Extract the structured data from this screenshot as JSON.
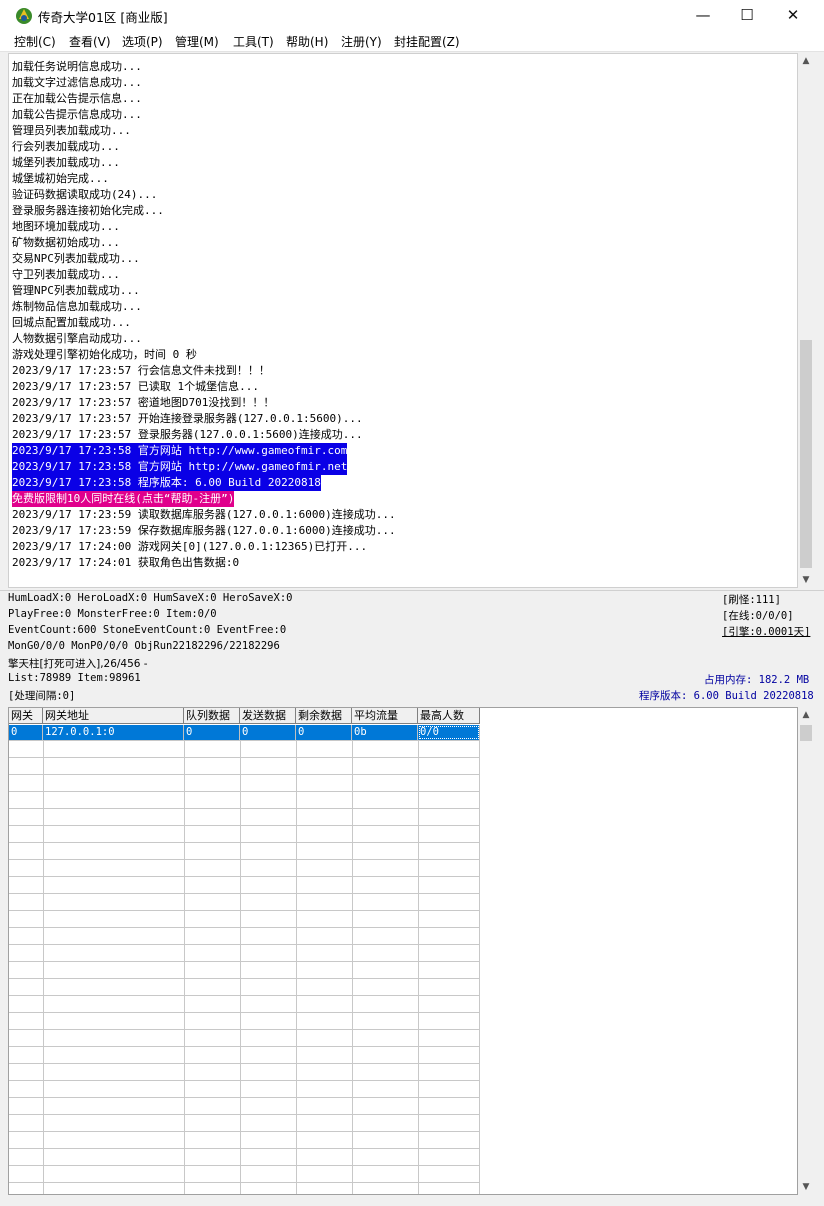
{
  "window": {
    "title": "传奇大学01区 [商业版]",
    "minimize": "—",
    "maximize": "☐",
    "close": "✕"
  },
  "menu": [
    "控制(C)",
    "查看(V)",
    "选项(P)",
    "管理(M)",
    "工具(T)",
    "帮助(H)",
    "注册(Y)",
    "封挂配置(Z)"
  ],
  "log": {
    "lines": [
      "加载任务说明信息成功...",
      "加载文字过滤信息成功...",
      "正在加载公告提示信息...",
      "加载公告提示信息成功...",
      "管理员列表加载成功...",
      "行会列表加载成功...",
      "城堡列表加载成功...",
      "城堡城初始完成...",
      "验证码数据读取成功(24)...",
      "登录服务器连接初始化完成...",
      "地图环境加载成功...",
      "矿物数据初始成功...",
      "交易NPC列表加载成功...",
      "守卫列表加载成功...",
      "管理NPC列表加载成功...",
      "炼制物品信息加载成功...",
      "回城点配置加载成功...",
      "人物数据引擎启动成功...",
      "游戏处理引擎初始化成功，时间 0 秒",
      "2023/9/17 17:23:57 行会信息文件未找到！！！",
      "2023/9/17 17:23:57 已读取 1个城堡信息...",
      "2023/9/17 17:23:57 密道地图D701没找到！！！",
      "2023/9/17 17:23:57 开始连接登录服务器(127.0.0.1:5600)...",
      "2023/9/17 17:23:57 登录服务器(127.0.0.1:5600)连接成功...",
      "2023/9/17 17:23:58 官方网站 http://www.gameofmir.com",
      "2023/9/17 17:23:58 官方网站 http://www.gameofmir.net",
      "2023/9/17 17:23:58 程序版本: 6.00 Build 20220818",
      "免费版限制10人同时在线(点击“帮助-注册”)",
      "2023/9/17 17:23:59 读取数据库服务器(127.0.0.1:6000)连接成功...",
      "2023/9/17 17:23:59 保存数据库服务器(127.0.0.1:6000)连接成功...",
      "2023/9/17 17:24:00 游戏网关[0](127.0.0.1:12365)已打开...",
      "2023/9/17 17:24:01 获取角色出售数据:0"
    ],
    "highlight_blue_color": "#0a00e6",
    "highlight_pink_color": "#e0008c"
  },
  "status": {
    "line1": "HumLoadX:0 HeroLoadX:0 HumSaveX:0 HeroSaveX:0",
    "line2": "PlayFree:0 MonsterFree:0 Item:0/0",
    "line3": "EventCount:600 StoneEventCount:0 EventFree:0",
    "line4": "MonG0/0/0 MonP0/0/0 ObjRun22182296/22182296",
    "line5": "擎天柱[打死可进入],26/456 -",
    "line6": "List:78989 Item:98961",
    "line7": "[处理间隔:0]",
    "monster_refresh": "[刷怪:111]",
    "online": "[在线:0/0/0]",
    "engine": "[引擎:0.0001天]",
    "memory": "占用内存: 182.2 MB",
    "version": "程序版本: 6.00 Build 20220818"
  },
  "grid": {
    "columns": [
      "网关",
      "网关地址",
      "队列数据",
      "发送数据",
      "剩余数据",
      "平均流量",
      "最高人数"
    ],
    "rows": [
      [
        "0",
        "127.0.0.1:0",
        "0",
        "0",
        "0",
        "0b",
        "0/0"
      ]
    ]
  },
  "colors": {
    "selection": "#0078d7",
    "status_blue_text": "#0000a0"
  }
}
